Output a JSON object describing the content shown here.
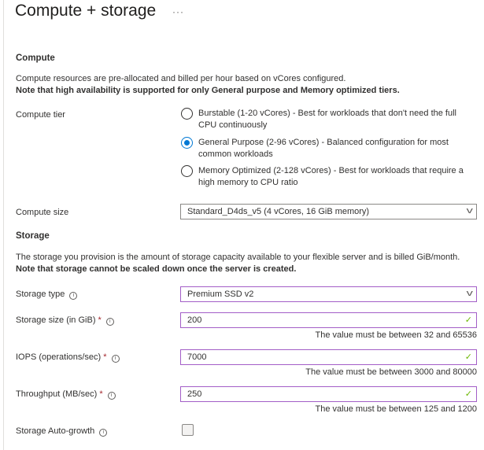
{
  "title": "Compute + storage",
  "more": "···",
  "compute": {
    "heading": "Compute",
    "desc": "Compute resources are pre-allocated and billed per hour based on vCores configured.",
    "note": "Note that high availability is supported for only General purpose and Memory optimized tiers.",
    "tier_label": "Compute tier",
    "tiers": [
      {
        "line1": "Burstable (1-20 vCores) - Best for workloads that don't need the full",
        "line2": "CPU continuously",
        "selected": false
      },
      {
        "line1": "General Purpose (2-96 vCores) - Balanced configuration for most",
        "line2": "common workloads",
        "selected": true
      },
      {
        "line1": "Memory Optimized (2-128 vCores) - Best for workloads that require a",
        "line2": "high memory to CPU ratio",
        "selected": false
      }
    ],
    "size_label": "Compute size",
    "size_value": "Standard_D4ds_v5 (4 vCores, 16 GiB memory)"
  },
  "storage": {
    "heading": "Storage",
    "desc": "The storage you provision is the amount of storage capacity available to your flexible server and is billed GiB/month.",
    "note": "Note that storage cannot be scaled down once the server is created.",
    "type_label": "Storage type",
    "type_value": "Premium SSD v2",
    "size_label": "Storage size (in GiB)",
    "size_value": "200",
    "size_hint": "The value must be between 32 and 65536",
    "iops_label": "IOPS (operations/sec)",
    "iops_value": "7000",
    "iops_hint": "The value must be between 3000 and 80000",
    "tp_label": "Throughput (MB/sec)",
    "tp_value": "250",
    "tp_hint": "The value must be between 125 and 1200",
    "autogrowth_label": "Storage Auto-growth",
    "autogrowth_checked": false
  },
  "req": "*",
  "info": "i",
  "check": "✓",
  "chev": "v"
}
